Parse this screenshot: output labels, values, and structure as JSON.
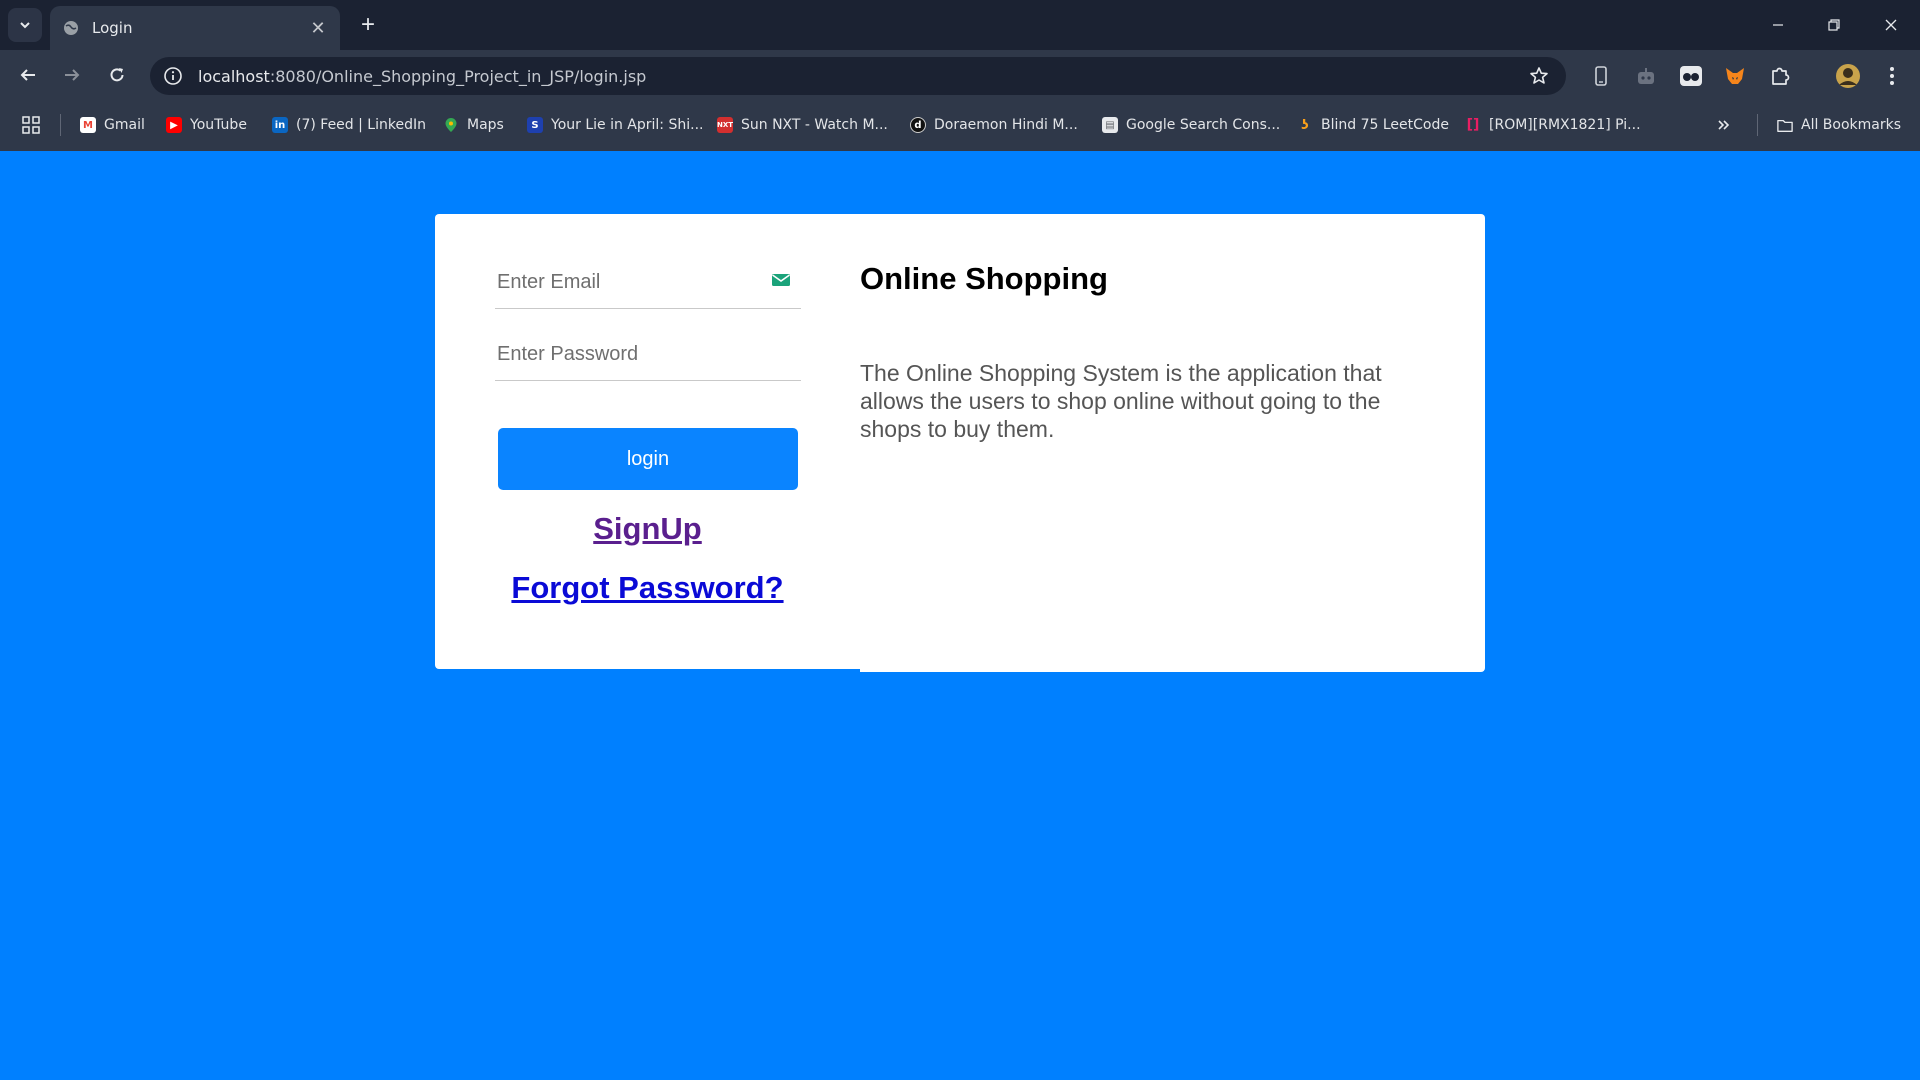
{
  "browser": {
    "tab": {
      "title": "Login"
    },
    "address_bar": {
      "host": "localhost",
      "path": ":8080/Online_Shopping_Project_in_JSP/login.jsp"
    },
    "bookmarks": [
      {
        "label": "Gmail",
        "icon": "gmail-icon",
        "color": "#ea4335"
      },
      {
        "label": "YouTube",
        "icon": "youtube-icon",
        "color": "#ff0000"
      },
      {
        "label": "(7) Feed | LinkedIn",
        "icon": "linkedin-icon",
        "color": "#0a66c2"
      },
      {
        "label": "Maps",
        "icon": "maps-icon",
        "color": "#34a853"
      },
      {
        "label": "Your Lie in April: Shi...",
        "icon": "bookmark-favicon",
        "color": "#1e40af"
      },
      {
        "label": "Sun NXT - Watch M...",
        "icon": "sunnxt-icon",
        "color": "#d32f2f"
      },
      {
        "label": "Doraemon Hindi M...",
        "icon": "bookmark-favicon",
        "color": "#111111"
      },
      {
        "label": "Google Search Cons...",
        "icon": "search-console-icon",
        "color": "#5f6368"
      },
      {
        "label": "Blind 75 LeetCode",
        "icon": "leetcode-icon",
        "color": "#f89f1b"
      },
      {
        "label": "[ROM][RMX1821] Pi...",
        "icon": "bookmark-favicon",
        "color": "#e91e63"
      }
    ],
    "all_bookmarks": "All Bookmarks"
  },
  "login_form": {
    "email_placeholder": "Enter Email",
    "password_placeholder": "Enter Password",
    "login_label": "login",
    "signup_label": "SignUp",
    "forgot_label": "Forgot Password?"
  },
  "info": {
    "title": "Online Shopping",
    "description": "The Online Shopping System is the application that allows the users to shop online without going to the shops to buy them."
  },
  "colors": {
    "page_background": "#0080ff",
    "login_button": "#0a84ff",
    "signup_link": "#5a1f8e",
    "forgot_link": "#0a0ad6"
  }
}
